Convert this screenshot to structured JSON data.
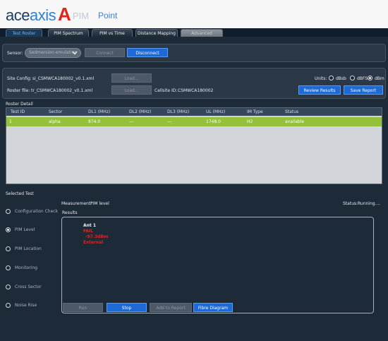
{
  "header": {
    "logo": {
      "ace": "ace",
      "axis": "axis",
      "a": "A",
      "pim": "PIM",
      "point": "Point"
    }
  },
  "tabs": [
    {
      "label": "Test Roster",
      "state": "active"
    },
    {
      "label": "PIM Spectrum",
      "state": "normal"
    },
    {
      "label": "PIM vs Time",
      "state": "normal"
    },
    {
      "label": "Distance Mapping",
      "state": "normal"
    },
    {
      "label": "Advanced",
      "state": "disabled"
    }
  ],
  "sensor": {
    "label": "Sensor:",
    "value": "Sedmersion-emulation",
    "connect_label": "Connect",
    "disconnect_label": "Disconnect"
  },
  "config": {
    "site_config_label": "Site Config:",
    "site_config_value": "si_CSMWCA180002_v0.1.xml",
    "roster_file_label": "Roster file:",
    "roster_file_value": "tr_CSMWCA180002_v0.1.xml",
    "load_label": "Load...",
    "cellsite_label": "Cellsite ID:",
    "cellsite_value": "CSMWCA180002",
    "units_label": "Units:",
    "units": [
      "dBsb",
      "dBFS",
      "dBm"
    ],
    "units_selected": "dBm",
    "review_label": "Review Results",
    "save_label": "Save Report"
  },
  "roster": {
    "title": "Roster Detail",
    "columns": [
      "Test ID",
      "Sector",
      "DL1 (MHz)",
      "DL2 (MHz)",
      "DL3 (MHz)",
      "UL (MHz)",
      "IM Type",
      "Status"
    ],
    "rows": [
      [
        "1",
        "alpha",
        "874.0",
        "---",
        "---",
        "1748.0",
        "H2",
        "available"
      ]
    ],
    "row_color": "#93c13a"
  },
  "selected_test": {
    "title": "Selected Test",
    "measurement_label": "Measurement:",
    "measurement_value": "PIM level",
    "status_label": "Status:",
    "status_value": "Running....",
    "results_label": "Results",
    "tests": [
      {
        "label": "Configuration Check",
        "selected": false
      },
      {
        "label": "PIM Level",
        "selected": true
      },
      {
        "label": "PIM Location",
        "selected": false
      },
      {
        "label": "Monitoring",
        "selected": false
      },
      {
        "label": "Cross Sector",
        "selected": false
      },
      {
        "label": "Noise Rise",
        "selected": false
      }
    ],
    "results": {
      "ant": "Ant 1",
      "verdict": "FAIL",
      "value": "-97.3dBm",
      "location": "External"
    },
    "buttons": {
      "run": "Run",
      "stop": "Stop",
      "add_report": "Add to Report",
      "fibre": "Fibre Diagram"
    }
  },
  "colors": {
    "accent": "#1d6ad6",
    "fail": "#e0251b",
    "available": "#93c13a"
  }
}
